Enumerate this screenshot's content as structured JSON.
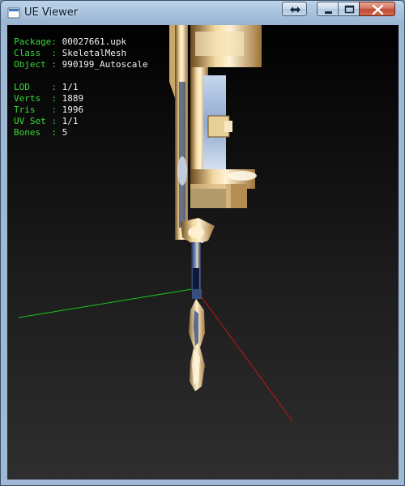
{
  "window": {
    "title": "UE Viewer"
  },
  "titlebar_buttons": {
    "swap": "swap-arrows-icon",
    "minimize": "minimize-icon",
    "maximize": "maximize-icon",
    "close": "close-icon"
  },
  "info": {
    "package_key": "Package: ",
    "package_value": "00027661.upk",
    "class_key": "Class  : ",
    "class_value": "SkeletalMesh",
    "object_key": "Object : ",
    "object_value": "990199_Autoscale",
    "lod_key": "LOD    : ",
    "lod_value": "1/1",
    "verts_key": "Verts  : ",
    "verts_value": "1889",
    "tris_key": "Tris   : ",
    "tris_value": "1996",
    "uvset_key": "UV Set : ",
    "uvset_value": "1/1",
    "bones_key": "Bones  : ",
    "bones_value": "5"
  },
  "colors": {
    "label_green": "#38d838",
    "value_white": "#f2f2f2",
    "axis_x": "#c01818",
    "axis_y": "#19c919"
  }
}
